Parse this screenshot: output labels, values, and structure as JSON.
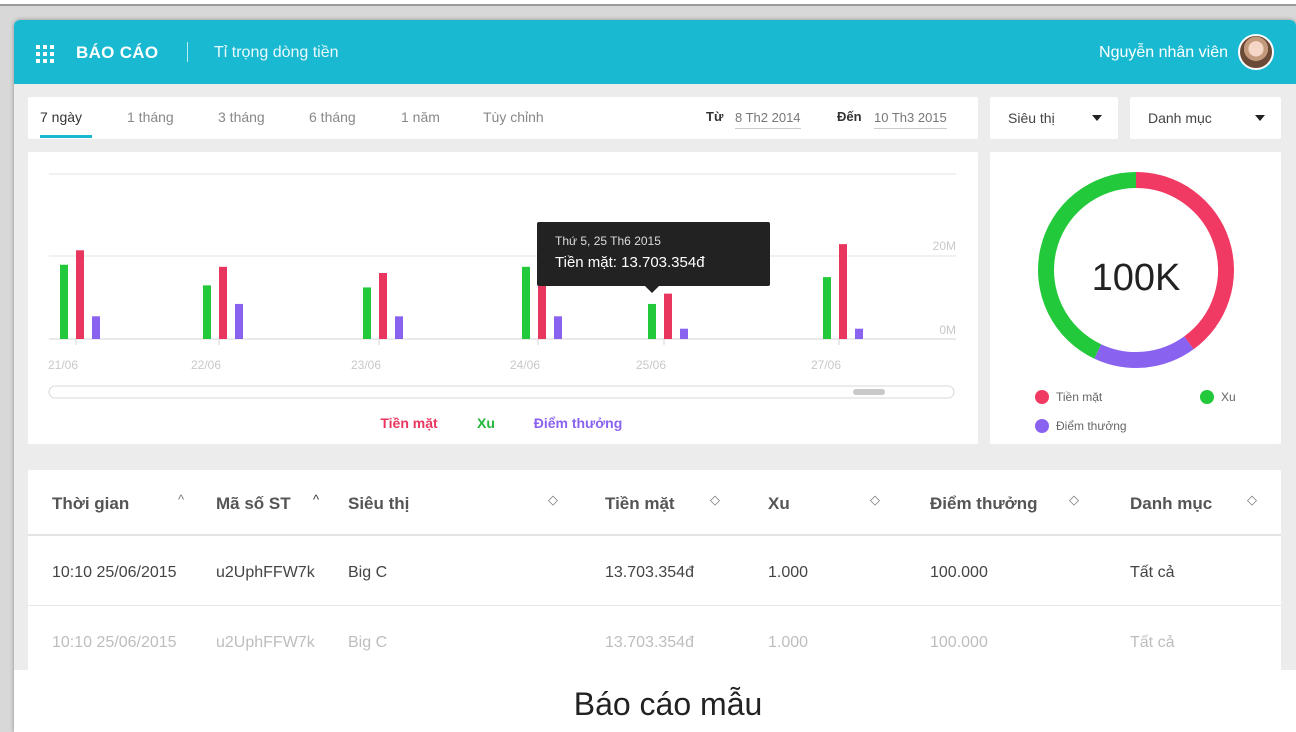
{
  "header": {
    "title": "BÁO CÁO",
    "subtitle": "Tỉ trọng dòng tiền",
    "user": "Nguyễn nhân viên",
    "color": "#1ab9d2"
  },
  "filters": {
    "tabs": [
      "7 ngày",
      "1 tháng",
      "3 tháng",
      "6 tháng",
      "1 năm",
      "Tùy chỉnh"
    ],
    "from_label": "Từ",
    "from_value": "8 Th2 2014",
    "to_label": "Đến",
    "to_value": "10 Th3 2015",
    "select_store": "Siêu thị",
    "select_category": "Danh mục"
  },
  "tooltip": {
    "date": "Thứ 5, 25 Th6 2015",
    "value": "Tiền mặt: 13.703.354đ"
  },
  "chart_data": {
    "type": "bar",
    "categories": [
      "21/06",
      "22/06",
      "23/06",
      "24/06",
      "25/06",
      "27/06"
    ],
    "series": [
      {
        "name": "Xu",
        "color": "#22c93a",
        "values": [
          18,
          13,
          12.5,
          17.5,
          8.5,
          15
        ]
      },
      {
        "name": "Tiền mặt",
        "color": "#e8365e",
        "values": [
          21.5,
          17.5,
          16,
          21,
          11,
          23
        ]
      },
      {
        "name": "Điểm thưởng",
        "color": "#8a62f0",
        "values": [
          5.5,
          8.5,
          5.5,
          5.5,
          2.5,
          2.5
        ]
      }
    ],
    "ytick_labels": [
      "20M",
      "0M"
    ],
    "ylim": [
      0,
      40
    ],
    "legend": [
      "Tiền mặt",
      "Xu",
      "Điểm thưởng"
    ]
  },
  "donut": {
    "center_label": "100K",
    "slices": [
      {
        "name": "Tiền mặt",
        "value": 40,
        "color": "#f03a63"
      },
      {
        "name": "Điểm thưởng",
        "value": 17,
        "color": "#8a62f0"
      },
      {
        "name": "Xu",
        "value": 43,
        "color": "#22c93a"
      }
    ],
    "legend": [
      "Tiền mặt",
      "Xu",
      "Điểm thưởng"
    ]
  },
  "table": {
    "columns": [
      "Thời gian",
      "Mã số ST",
      "Siêu thị",
      "Tiền mặt",
      "Xu",
      "Điểm thưởng",
      "Danh mục"
    ],
    "rows": [
      [
        "10:10 25/06/2015",
        "u2UphFFW7k",
        "Big C",
        "13.703.354đ",
        "1.000",
        "100.000",
        "Tất cả"
      ],
      [
        "10:10 25/06/2015",
        "u2UphFFW7k",
        "Big C",
        "13.703.354đ",
        "1.000",
        "100.000",
        "Tất cả"
      ]
    ]
  },
  "caption": "Báo cáo mẫu"
}
